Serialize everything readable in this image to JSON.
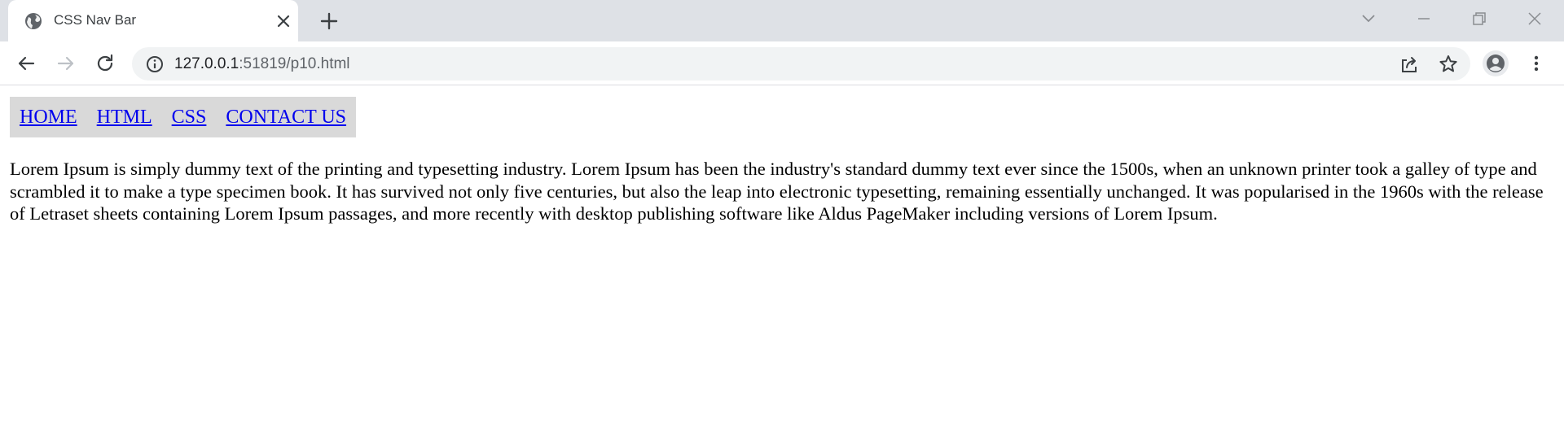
{
  "browser": {
    "tab": {
      "title": "CSS Nav Bar",
      "favicon": "globe-icon"
    },
    "address_bar": {
      "host": "127.0.0.1",
      "rest": ":51819/p10.html"
    },
    "icons": {
      "back": "arrow-left-icon",
      "forward": "arrow-right-icon",
      "reload": "reload-icon",
      "site_info": "info-icon",
      "share": "share-icon",
      "bookmark": "star-icon",
      "profile": "profile-icon",
      "menu": "kebab-menu-icon",
      "new_tab": "plus-icon",
      "tab_close": "close-icon",
      "tab_search": "chevron-down-icon",
      "minimize": "minimize-icon",
      "restore": "restore-icon",
      "close_window": "close-icon"
    }
  },
  "page": {
    "nav": {
      "items": [
        {
          "label": "HOME"
        },
        {
          "label": "HTML"
        },
        {
          "label": "CSS"
        },
        {
          "label": "CONTACT US"
        }
      ],
      "background": "#d9d9d9",
      "link_color": "#0000ee"
    },
    "paragraph": "Lorem Ipsum is simply dummy text of the printing and typesetting industry. Lorem Ipsum has been the industry's standard dummy text ever since the 1500s, when an unknown printer took a galley of type and scrambled it to make a type specimen book. It has survived not only five centuries, but also the leap into electronic typesetting, remaining essentially unchanged. It was popularised in the 1960s with the release of Letraset sheets containing Lorem Ipsum passages, and more recently with desktop publishing software like Aldus PageMaker including versions of Lorem Ipsum."
  }
}
